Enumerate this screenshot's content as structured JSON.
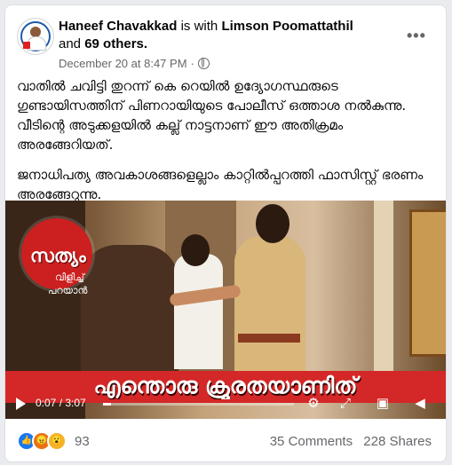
{
  "post": {
    "author": "Haneef Chavakkad",
    "with_text": "is with",
    "tagged": "Limson Poomattathil",
    "and_text": "and",
    "others": "69 others.",
    "timestamp": "December 20 at 8:47 PM",
    "dot": "·",
    "more_label": "•••",
    "paragraphs": [
      "വാതിൽ ചവിട്ടി തുറന്ന് കെ റെയിൽ ഉദ്യോഗസ്ഥരുടെ ഗുണ്ടായിസത്തിന് പിണറായിയുടെ പോലീസ് ഒത്താശ നൽകുന്നു. വീടിന്റെ അടുക്കളയിൽ കല്ല് നാട്ടനാണ് ഈ അതിക്രമം അരങ്ങേറിയത്.",
      "ജനാധിപത്യ അവകാശങ്ങളെല്ലാം കാറ്റിൽപ്പറത്തി ഫാസിസ്റ്റ് ഭരണം അരങ്ങേറുന്നു."
    ]
  },
  "video": {
    "logo_line1": "സത്യം",
    "logo_line2": "വിളിച്ച്",
    "logo_line3": "പറയാൻ",
    "caption": "എന്തൊരു ക്രൂരതയാണിത്",
    "time": "0:07 / 3:07",
    "progress": 0.04,
    "icons": [
      "play-icon",
      "settings-icon",
      "fullscreen-icon",
      "pip-icon",
      "volume-icon"
    ]
  },
  "footer": {
    "reaction_icons": [
      "like",
      "angry",
      "wow"
    ],
    "reaction_count": "93",
    "comments": "35 Comments",
    "shares": "228 Shares"
  }
}
